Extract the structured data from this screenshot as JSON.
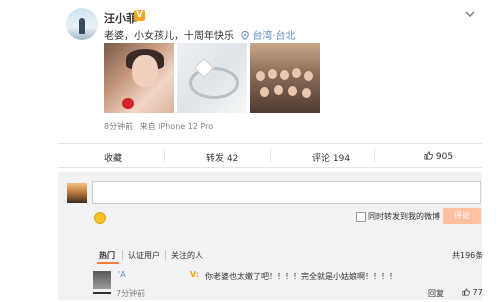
{
  "post": {
    "author": "汪小菲",
    "verified_badge": "V",
    "text": "老婆，小女孩儿，十周年快乐",
    "location": "台湾·台北",
    "time": "8分钟前",
    "source": "来自 iPhone 12 Pro"
  },
  "actions": {
    "favorite": "收藏",
    "repost": "转发 42",
    "comment": "评论 194",
    "like": "905"
  },
  "composer": {
    "forward_label": "同时转发到我的微博",
    "submit_label": "评论"
  },
  "comments_tabs": {
    "tabs": [
      "热门",
      "认证用户",
      "关注的人"
    ],
    "total": "共196条"
  },
  "comment": {
    "user": "'A",
    "vip": "V:",
    "text": "你老婆也太嫩了吧！！！！完全就是小姑娘啊！！！！",
    "time": "7分钟前",
    "reply": "回复",
    "likes": "77"
  },
  "colors": {
    "accent": "#fa7d3c",
    "link": "#5f8ec7",
    "badge": "#f7a51c",
    "button_disabled": "#ffbfa1"
  }
}
